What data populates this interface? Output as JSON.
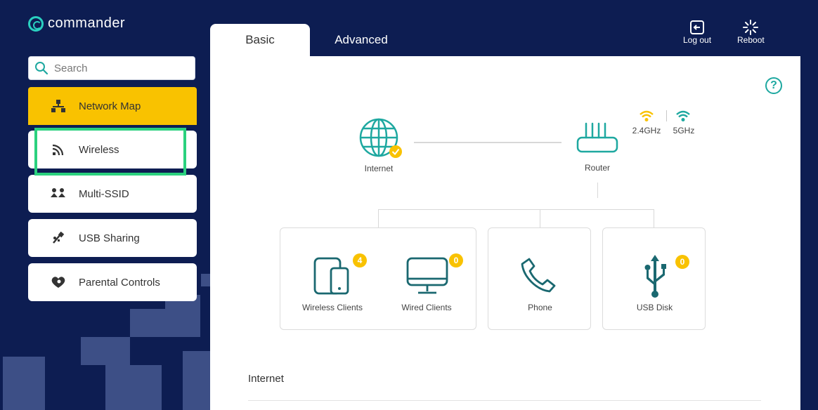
{
  "brand": {
    "name": "commander"
  },
  "search": {
    "placeholder": "Search"
  },
  "sidebar": {
    "items": [
      {
        "label": "Network Map",
        "icon": "network-map-icon",
        "active": true
      },
      {
        "label": "Wireless",
        "icon": "wireless-icon"
      },
      {
        "label": "Multi-SSID",
        "icon": "multi-ssid-icon"
      },
      {
        "label": "USB Sharing",
        "icon": "usb-sharing-icon"
      },
      {
        "label": "Parental Controls",
        "icon": "parental-controls-icon"
      }
    ]
  },
  "tabs": [
    {
      "label": "Basic",
      "active": true
    },
    {
      "label": "Advanced"
    }
  ],
  "header": {
    "logout_label": "Log out",
    "reboot_label": "Reboot"
  },
  "map": {
    "internet_label": "Internet",
    "router_label": "Router",
    "band_24_label": "2.4GHz",
    "band_5_label": "5GHz",
    "wireless_clients": {
      "label": "Wireless Clients",
      "count": "4"
    },
    "wired_clients": {
      "label": "Wired Clients",
      "count": "0"
    },
    "phone": {
      "label": "Phone"
    },
    "usb_disk": {
      "label": "USB Disk",
      "count": "0"
    }
  },
  "section": {
    "title": "Internet"
  },
  "colors": {
    "background": "#0d1d52",
    "accent": "#f9c200",
    "teal": "#1ea8a0",
    "highlight": "#2bd17e"
  }
}
